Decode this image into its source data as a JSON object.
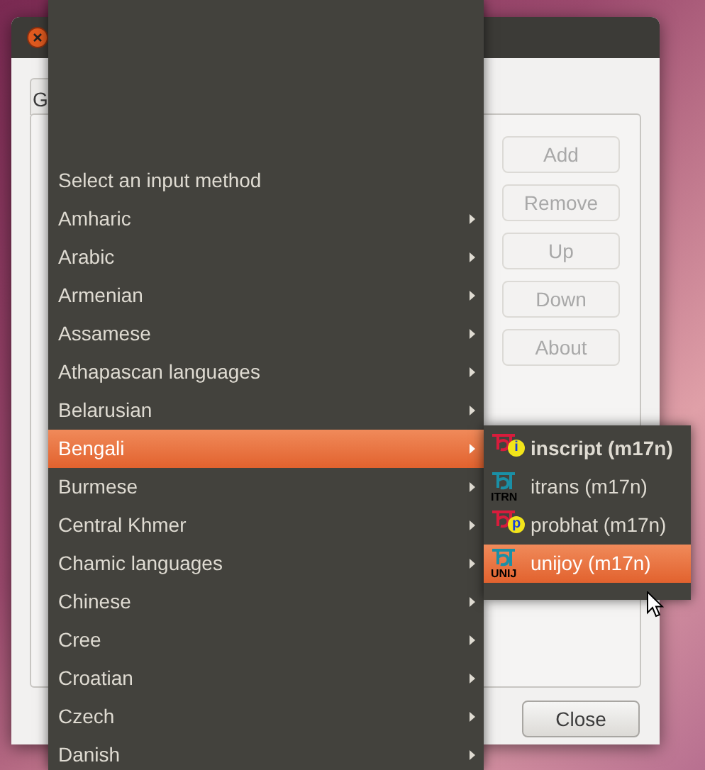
{
  "window": {
    "tab": "G",
    "buttons": [
      {
        "label": "Add",
        "disabled": true
      },
      {
        "label": "Remove",
        "disabled": true
      },
      {
        "label": "Up",
        "disabled": true
      },
      {
        "label": "Down",
        "disabled": true
      },
      {
        "label": "About",
        "disabled": true
      }
    ],
    "close_button": {
      "label": "Close",
      "disabled": false
    }
  },
  "menu": {
    "header": "Select an input method",
    "items": [
      {
        "label": "Amharic",
        "selected": false
      },
      {
        "label": "Arabic",
        "selected": false
      },
      {
        "label": "Armenian",
        "selected": false
      },
      {
        "label": "Assamese",
        "selected": false
      },
      {
        "label": "Athapascan languages",
        "selected": false
      },
      {
        "label": "Belarusian",
        "selected": false
      },
      {
        "label": "Bengali",
        "selected": true
      },
      {
        "label": "Burmese",
        "selected": false
      },
      {
        "label": "Central Khmer",
        "selected": false
      },
      {
        "label": "Chamic languages",
        "selected": false
      },
      {
        "label": "Chinese",
        "selected": false
      },
      {
        "label": "Cree",
        "selected": false
      },
      {
        "label": "Croatian",
        "selected": false
      },
      {
        "label": "Czech",
        "selected": false
      },
      {
        "label": "Danish",
        "selected": false
      }
    ]
  },
  "submenu": {
    "items": [
      {
        "label": "inscript (m17n)",
        "bold": true,
        "selected": false,
        "kind": "circle",
        "badge": "i",
        "color": "#d81c3c"
      },
      {
        "label": "itrans (m17n)",
        "bold": false,
        "selected": false,
        "kind": "label",
        "badge": "ITRN",
        "color": "#1a8fa6"
      },
      {
        "label": "probhat (m17n)",
        "bold": false,
        "selected": false,
        "kind": "circle",
        "badge": "p",
        "color": "#d81c3c"
      },
      {
        "label": "unijoy (m17n)",
        "bold": false,
        "selected": true,
        "kind": "label",
        "badge": "UNIJ",
        "color": "#1a8fa6"
      }
    ]
  }
}
